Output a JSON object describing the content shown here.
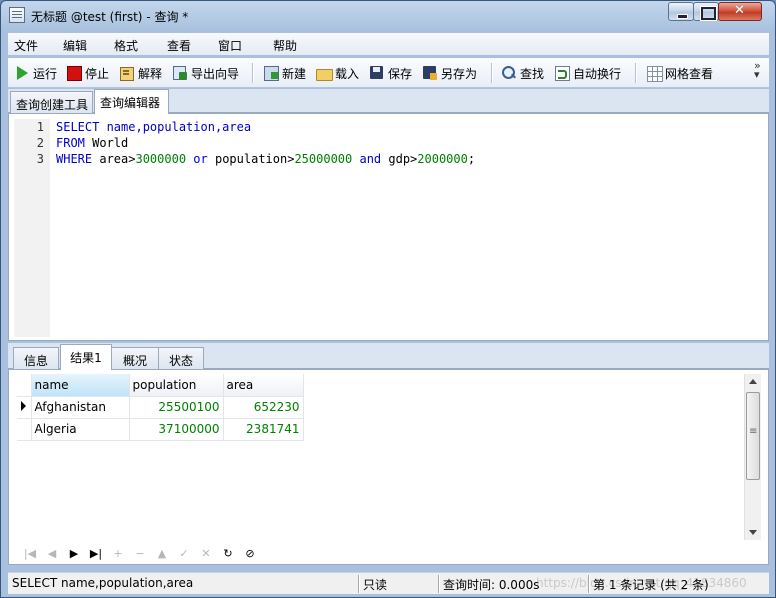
{
  "window": {
    "title": "无标题 @test (first) - 查询 *"
  },
  "menu": [
    "文件",
    "编辑",
    "格式",
    "查看",
    "窗口",
    "帮助"
  ],
  "toolbar": {
    "run": "运行",
    "stop": "停止",
    "explain": "解释",
    "export_wizard": "导出向导",
    "new": "新建",
    "load": "载入",
    "save": "保存",
    "save_as": "另存为",
    "find": "查找",
    "word_wrap": "自动换行",
    "grid_view": "网格查看",
    "more": "»"
  },
  "editor_tabs": [
    "查询创建工具",
    "查询编辑器"
  ],
  "editor": {
    "line_numbers": [
      "1",
      "2",
      "3"
    ],
    "line1": {
      "kw1": "SELECT",
      "rest": " name,population,area"
    },
    "line2": {
      "kw1": "FROM",
      "rest": " World"
    },
    "line3": {
      "kw1": "WHERE",
      "t1": " area>",
      "n1": "3000000",
      "kw2": " or",
      "t2": " population>",
      "n2": "25000000",
      "kw3": " and",
      "t3": " gdp>",
      "n3": "2000000",
      "t4": ";"
    }
  },
  "result_tabs": [
    "信息",
    "结果1",
    "概况",
    "状态"
  ],
  "result_grid": {
    "columns": [
      "name",
      "population",
      "area"
    ],
    "rows": [
      [
        "Afghanistan",
        "25500100",
        "652230"
      ],
      [
        "Algeria",
        "37100000",
        "2381741"
      ]
    ]
  },
  "navigator": [
    "|◀",
    "◀",
    "▶",
    "▶|",
    "+",
    "−",
    "▲",
    "✓",
    "✕",
    "↻",
    "⊘"
  ],
  "status_bar": {
    "sql": "SELECT name,population,area",
    "mode": "只读",
    "query_time": "查询时间: 0.000s",
    "watermark": "https://blog.csdn.net/qq_41834860",
    "records": "第 1 条记录 (共 2 条)"
  }
}
